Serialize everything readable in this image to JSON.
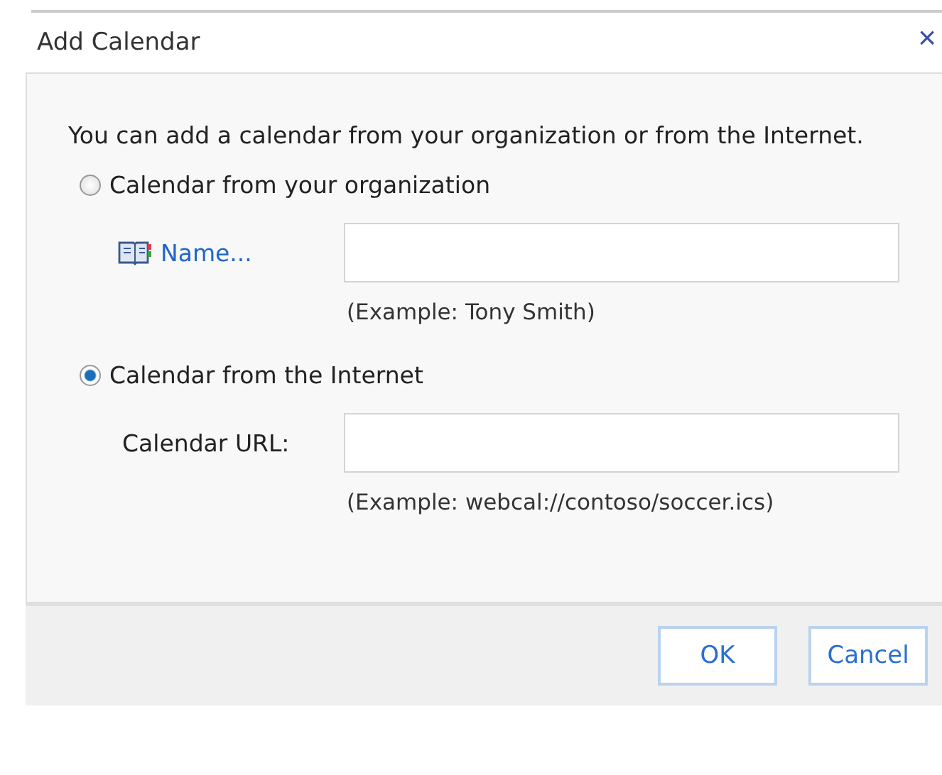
{
  "dialog": {
    "title": "Add Calendar",
    "close": "×"
  },
  "intro": "You can add a calendar from your organization or from the Internet.",
  "options": [
    {
      "label": "Calendar from your organization",
      "selected": false,
      "field": {
        "kind": "link",
        "label": "Name..."
      },
      "example": "(Example: Tony Smith)"
    },
    {
      "label": "Calendar from the Internet",
      "selected": true,
      "field": {
        "kind": "label",
        "label": "Calendar URL:"
      },
      "example": "(Example: webcal://contoso/soccer.ics)"
    }
  ],
  "buttons": [
    "OK",
    "Cancel"
  ]
}
